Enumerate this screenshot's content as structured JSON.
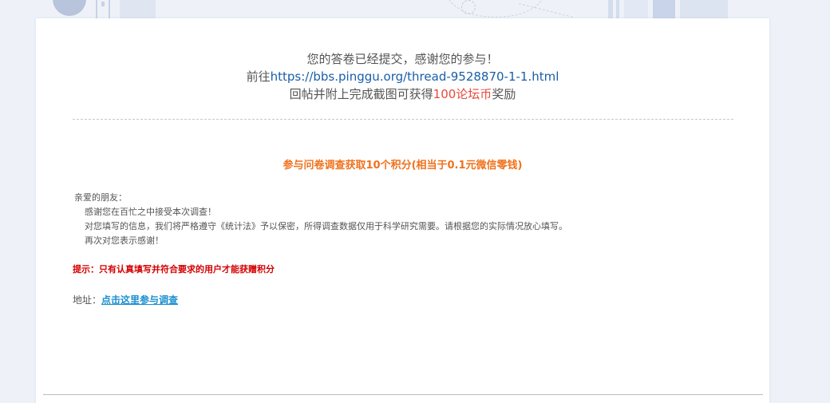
{
  "confirmation": {
    "line1": "您的答卷已经提交，感谢您的参与！",
    "line2_prefix": "前往",
    "line2_link": "https://bbs.pinggu.org/thread-9528870-1-1.html",
    "line3_prefix": "回帖并附上完成截图可获得",
    "line3_reward": "100论坛币",
    "line3_suffix": "奖励"
  },
  "survey": {
    "headline": "参与问卷调查获取10个积分(相当于0.1元微信零钱)",
    "greeting": "亲爱的朋友：",
    "paragraphs": [
      "感谢您在百忙之中接受本次调查！",
      "对您填写的信息，我们将严格遵守《统计法》予以保密，所得调查数据仅用于科学研究需要。请根据您的实际情况放心填写。",
      "再次对您表示感谢！"
    ],
    "hint": "提示：只有认真填写并符合要求的用户才能获赠积分",
    "address_label": "地址：",
    "address_link": "点击这里参与调查"
  },
  "colors": {
    "link_blue": "#1a5ea8",
    "reward_red": "#e64a3b",
    "headline_orange": "#f0711c",
    "hint_red": "#d40000",
    "survey_link": "#1a8fd0"
  }
}
